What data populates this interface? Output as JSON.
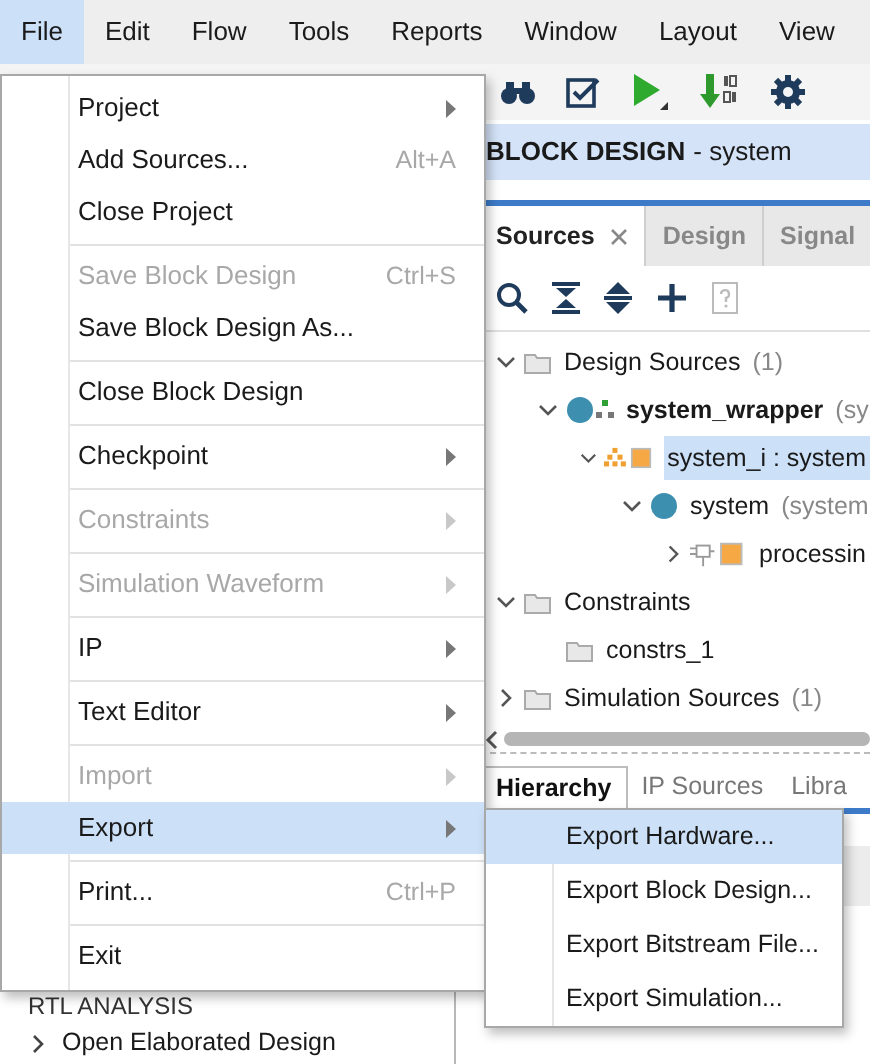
{
  "menubar": [
    {
      "label": "File",
      "selected": true
    },
    {
      "label": "Edit",
      "selected": false
    },
    {
      "label": "Flow",
      "selected": false
    },
    {
      "label": "Tools",
      "selected": false
    },
    {
      "label": "Reports",
      "selected": false
    },
    {
      "label": "Window",
      "selected": false
    },
    {
      "label": "Layout",
      "selected": false
    },
    {
      "label": "View",
      "selected": false
    }
  ],
  "header": {
    "title": "BLOCK DESIGN",
    "subtitle": "- system"
  },
  "sources_tabs": [
    {
      "label": "Sources",
      "selected": true,
      "closable": true
    },
    {
      "label": "Design",
      "selected": false
    },
    {
      "label": "Signal",
      "selected": false
    }
  ],
  "tree": [
    {
      "kind": "folder",
      "label": "Design Sources",
      "detail": "(1)",
      "expanded": true,
      "selected": false,
      "children": [
        {
          "kind": "wrapper",
          "label": "system_wrapper",
          "detail": "(sy",
          "top": true,
          "expanded": true,
          "selected": false,
          "children": [
            {
              "kind": "instance",
              "label": "system_i : system",
              "expanded": true,
              "selected": true,
              "children": [
                {
                  "kind": "design",
                  "label": "system",
                  "detail": "(system",
                  "expanded": true,
                  "selected": false,
                  "children": [
                    {
                      "kind": "module",
                      "label": "processin",
                      "expanded": false,
                      "selected": false
                    }
                  ]
                }
              ]
            }
          ]
        }
      ]
    },
    {
      "kind": "folder",
      "label": "Constraints",
      "expanded": true,
      "selected": false,
      "children": [
        {
          "kind": "folder",
          "label": "constrs_1",
          "selected": false
        }
      ]
    },
    {
      "kind": "folder",
      "label": "Simulation Sources",
      "detail": "(1)",
      "expanded": false,
      "selected": false
    }
  ],
  "bottom_tabs": [
    {
      "label": "Hierarchy",
      "selected": true
    },
    {
      "label": "IP Sources",
      "selected": false
    },
    {
      "label": "Libra",
      "selected": false
    }
  ],
  "flow_navigator": {
    "section": "RTL ANALYSIS",
    "items": [
      {
        "label": "Open Elaborated Design",
        "expanded": false
      }
    ]
  },
  "file_menu": {
    "groups": [
      [
        {
          "label": "Project",
          "submenu": true,
          "disabled": false,
          "selected": false
        },
        {
          "label": "Add Sources...",
          "shortcut": "Alt+A",
          "disabled": false,
          "selected": false
        },
        {
          "label": "Close Project",
          "disabled": false,
          "selected": false
        }
      ],
      [
        {
          "label": "Save Block Design",
          "shortcut": "Ctrl+S",
          "disabled": true,
          "selected": false
        },
        {
          "label": "Save Block Design As...",
          "disabled": false,
          "selected": false
        }
      ],
      [
        {
          "label": "Close Block Design",
          "disabled": false,
          "selected": false
        }
      ],
      [
        {
          "label": "Checkpoint",
          "submenu": true,
          "disabled": false,
          "selected": false
        }
      ],
      [
        {
          "label": "Constraints",
          "submenu": true,
          "disabled": true,
          "selected": false
        }
      ],
      [
        {
          "label": "Simulation Waveform",
          "submenu": true,
          "disabled": true,
          "selected": false
        }
      ],
      [
        {
          "label": "IP",
          "submenu": true,
          "disabled": false,
          "selected": false
        }
      ],
      [
        {
          "label": "Text Editor",
          "submenu": true,
          "disabled": false,
          "selected": false
        }
      ],
      [
        {
          "label": "Import",
          "submenu": true,
          "disabled": true,
          "selected": false
        },
        {
          "label": "Export",
          "submenu": true,
          "disabled": false,
          "selected": true
        }
      ],
      [
        {
          "label": "Print...",
          "shortcut": "Ctrl+P",
          "disabled": false,
          "selected": false
        }
      ],
      [
        {
          "label": "Exit",
          "disabled": false,
          "selected": false
        }
      ]
    ]
  },
  "export_submenu": {
    "items": [
      {
        "label": "Export Hardware...",
        "selected": true
      },
      {
        "label": "Export Block Design...",
        "selected": false
      },
      {
        "label": "Export Bitstream File...",
        "selected": false
      },
      {
        "label": "Export Simulation...",
        "selected": false
      }
    ]
  }
}
